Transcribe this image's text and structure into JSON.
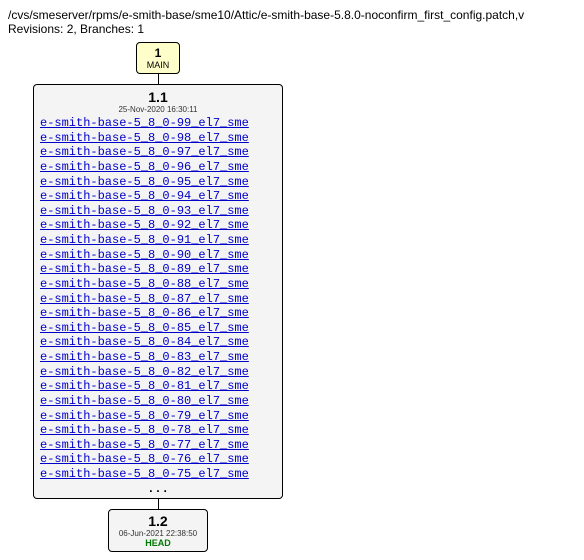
{
  "header": {
    "path": "/cvs/smeserver/rpms/e-smith-base/sme10/Attic/e-smith-base-5.8.0-noconfirm_first_config.patch,v",
    "revisions_line": "Revisions: 2, Branches: 1"
  },
  "branch_node": {
    "number": "1",
    "label": "MAIN"
  },
  "rev1": {
    "number": "1.1",
    "timestamp": "25-Nov-2020 16:30:11",
    "tags": [
      "e-smith-base-5_8_0-99_el7_sme",
      "e-smith-base-5_8_0-98_el7_sme",
      "e-smith-base-5_8_0-97_el7_sme",
      "e-smith-base-5_8_0-96_el7_sme",
      "e-smith-base-5_8_0-95_el7_sme",
      "e-smith-base-5_8_0-94_el7_sme",
      "e-smith-base-5_8_0-93_el7_sme",
      "e-smith-base-5_8_0-92_el7_sme",
      "e-smith-base-5_8_0-91_el7_sme",
      "e-smith-base-5_8_0-90_el7_sme",
      "e-smith-base-5_8_0-89_el7_sme",
      "e-smith-base-5_8_0-88_el7_sme",
      "e-smith-base-5_8_0-87_el7_sme",
      "e-smith-base-5_8_0-86_el7_sme",
      "e-smith-base-5_8_0-85_el7_sme",
      "e-smith-base-5_8_0-84_el7_sme",
      "e-smith-base-5_8_0-83_el7_sme",
      "e-smith-base-5_8_0-82_el7_sme",
      "e-smith-base-5_8_0-81_el7_sme",
      "e-smith-base-5_8_0-80_el7_sme",
      "e-smith-base-5_8_0-79_el7_sme",
      "e-smith-base-5_8_0-78_el7_sme",
      "e-smith-base-5_8_0-77_el7_sme",
      "e-smith-base-5_8_0-76_el7_sme",
      "e-smith-base-5_8_0-75_el7_sme"
    ],
    "ellipsis": "..."
  },
  "rev2": {
    "number": "1.2",
    "timestamp": "06-Jun-2021 22:38:50",
    "head_label": "HEAD"
  }
}
